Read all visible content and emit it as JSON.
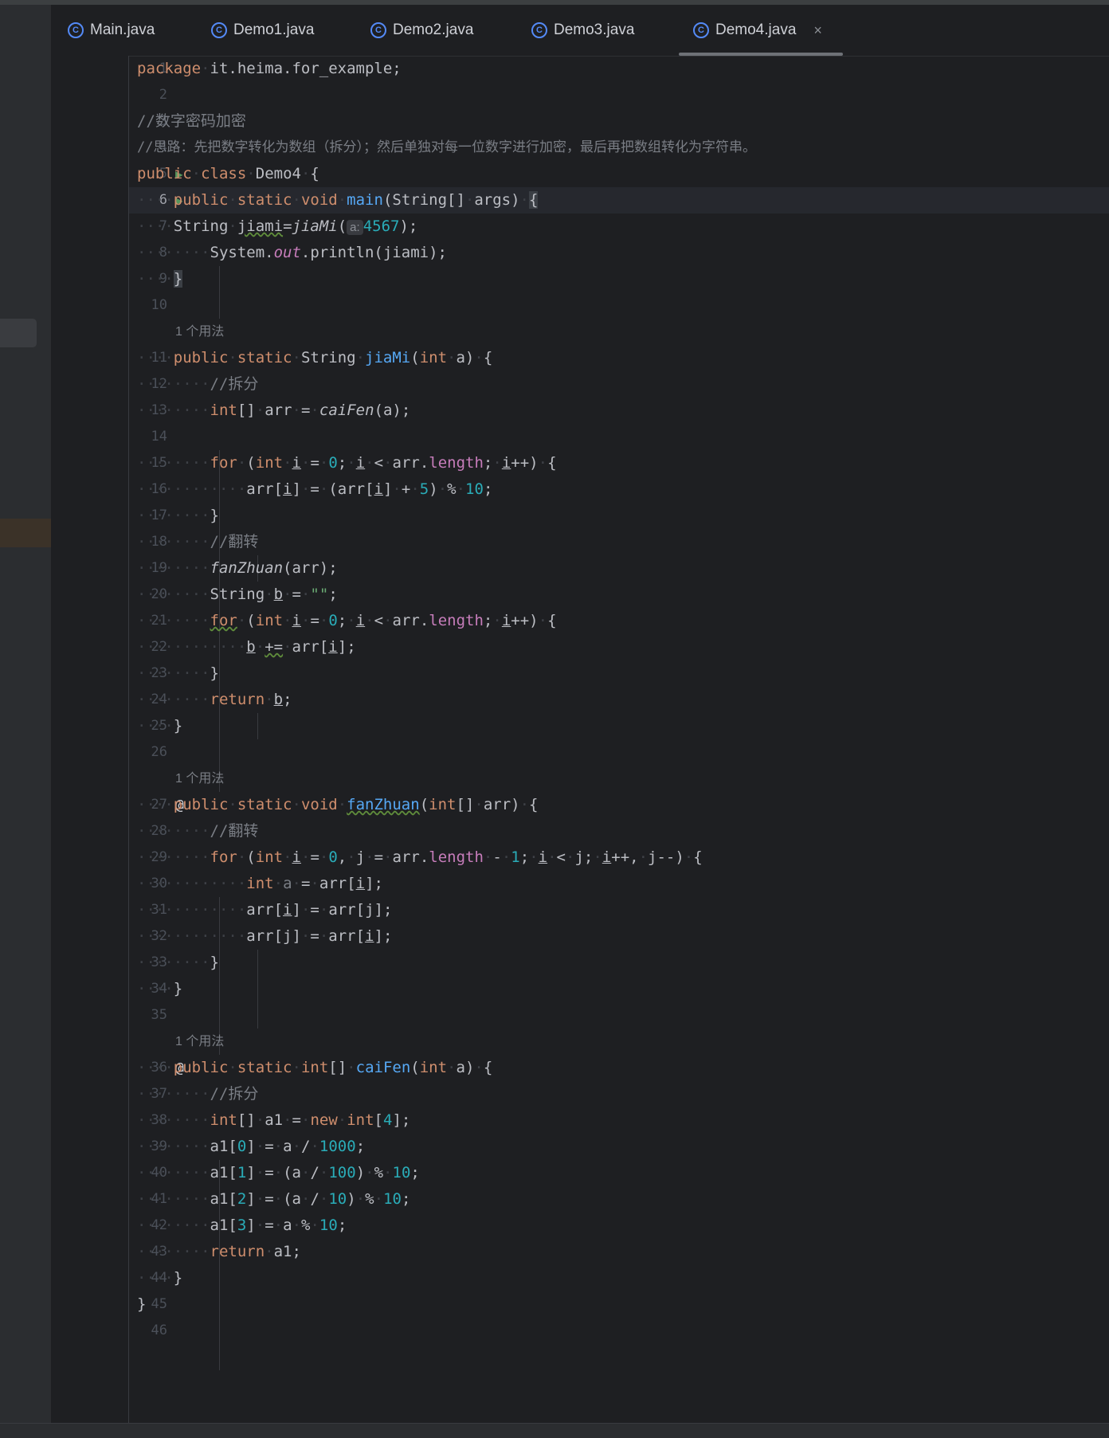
{
  "tabs": [
    {
      "label": "Main.java",
      "icon": "class-icon",
      "active": false
    },
    {
      "label": "Demo1.java",
      "icon": "class-icon",
      "active": false
    },
    {
      "label": "Demo2.java",
      "icon": "class-icon",
      "active": false
    },
    {
      "label": "Demo3.java",
      "icon": "class-icon",
      "active": false
    },
    {
      "label": "Demo4.java",
      "icon": "class-icon",
      "active": true
    }
  ],
  "tab_icon_glyph": "C",
  "close_glyph": "×",
  "run_glyph": "▶",
  "override_glyph": "@",
  "usage_hint": "1 个用法",
  "colors": {
    "keyword": "#cf8e6d",
    "function": "#56a8f5",
    "number": "#2aacb8",
    "string": "#6aab73",
    "comment": "#7a7e85",
    "field": "#c77dbb",
    "text": "#bcbec4"
  },
  "lines": [
    {
      "n": "1",
      "code": "package it.heima.for_example;"
    },
    {
      "n": "2",
      "code": ""
    },
    {
      "n": "3",
      "code": "//数字密码加密"
    },
    {
      "n": "4",
      "code": "//思路：先把数字转化为数组（拆分）；然后单独对每一位数字进行加密，最后再把数组转化为字符串。"
    },
    {
      "n": "5",
      "code": "public class Demo4 {",
      "gutter": "run"
    },
    {
      "n": "6",
      "code": "    public static void main(String[] args) {",
      "gutter": "run"
    },
    {
      "n": "7",
      "code": "    String jiami=jiaMi( a: 4567);",
      "param_hint": "a:"
    },
    {
      "n": "8",
      "code": "        System.out.println(jiami);"
    },
    {
      "n": "9",
      "code": "    }"
    },
    {
      "n": "10",
      "code": ""
    },
    {
      "n": "11",
      "code": "    public static String jiaMi(int a) {"
    },
    {
      "n": "12",
      "code": "        //拆分"
    },
    {
      "n": "13",
      "code": "        int[] arr = caiFen(a);"
    },
    {
      "n": "14",
      "code": ""
    },
    {
      "n": "15",
      "code": "        for (int i = 0; i < arr.length; i++) {"
    },
    {
      "n": "16",
      "code": "            arr[i] = (arr[i] + 5) % 10;"
    },
    {
      "n": "17",
      "code": "        }"
    },
    {
      "n": "18",
      "code": "        //翻转"
    },
    {
      "n": "19",
      "code": "        fanZhuan(arr);"
    },
    {
      "n": "20",
      "code": "        String b = \"\";"
    },
    {
      "n": "21",
      "code": "        for (int i = 0; i < arr.length; i++) {"
    },
    {
      "n": "22",
      "code": "            b += arr[i];"
    },
    {
      "n": "23",
      "code": "        }"
    },
    {
      "n": "24",
      "code": "        return b;"
    },
    {
      "n": "25",
      "code": "    }"
    },
    {
      "n": "26",
      "code": ""
    },
    {
      "n": "27",
      "code": "    public static void fanZhuan(int[] arr) {",
      "gutter": "override"
    },
    {
      "n": "28",
      "code": "        //翻转"
    },
    {
      "n": "29",
      "code": "        for (int i = 0, j = arr.length - 1; i < j; i++, j--) {"
    },
    {
      "n": "30",
      "code": "            int a = arr[i];"
    },
    {
      "n": "31",
      "code": "            arr[i] = arr[j];"
    },
    {
      "n": "32",
      "code": "            arr[j] = arr[i];"
    },
    {
      "n": "33",
      "code": "        }"
    },
    {
      "n": "34",
      "code": "    }"
    },
    {
      "n": "35",
      "code": ""
    },
    {
      "n": "36",
      "code": "    public static int[] caiFen(int a) {",
      "gutter": "override"
    },
    {
      "n": "37",
      "code": "        //拆分"
    },
    {
      "n": "38",
      "code": "        int[] a1 = new int[4];"
    },
    {
      "n": "39",
      "code": "        a1[0] = a / 1000;"
    },
    {
      "n": "40",
      "code": "        a1[1] = (a / 100) % 10;"
    },
    {
      "n": "41",
      "code": "        a1[2] = (a / 10) % 10;"
    },
    {
      "n": "42",
      "code": "        a1[3] = a % 10;"
    },
    {
      "n": "43",
      "code": "        return a1;"
    },
    {
      "n": "44",
      "code": "    }"
    },
    {
      "n": "45",
      "code": "}"
    },
    {
      "n": "46",
      "code": ""
    }
  ]
}
